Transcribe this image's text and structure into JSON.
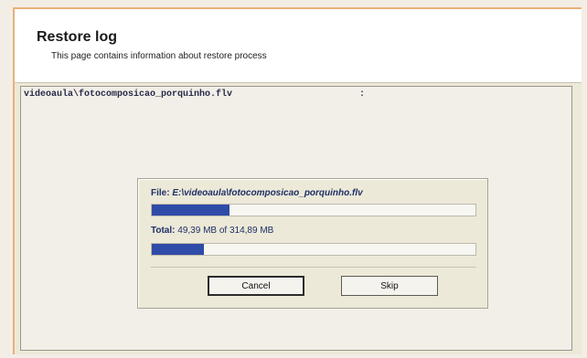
{
  "header": {
    "title": "Restore log",
    "subtitle": "This page contains information about restore process"
  },
  "log": {
    "entry_path": "videoaula\\fotocomposicao_porquinho.flv",
    "entry_separator": ":"
  },
  "progress": {
    "file_label": "File:",
    "file_value": "E:\\videoaula\\fotocomposicao_porquinho.flv",
    "file_progress_fraction": 0.24,
    "total_label": "Total:",
    "total_value": "49,39 MB of 314,89 MB",
    "total_progress_fraction": 0.16,
    "cancel_label": "Cancel",
    "skip_label": "Skip"
  }
}
